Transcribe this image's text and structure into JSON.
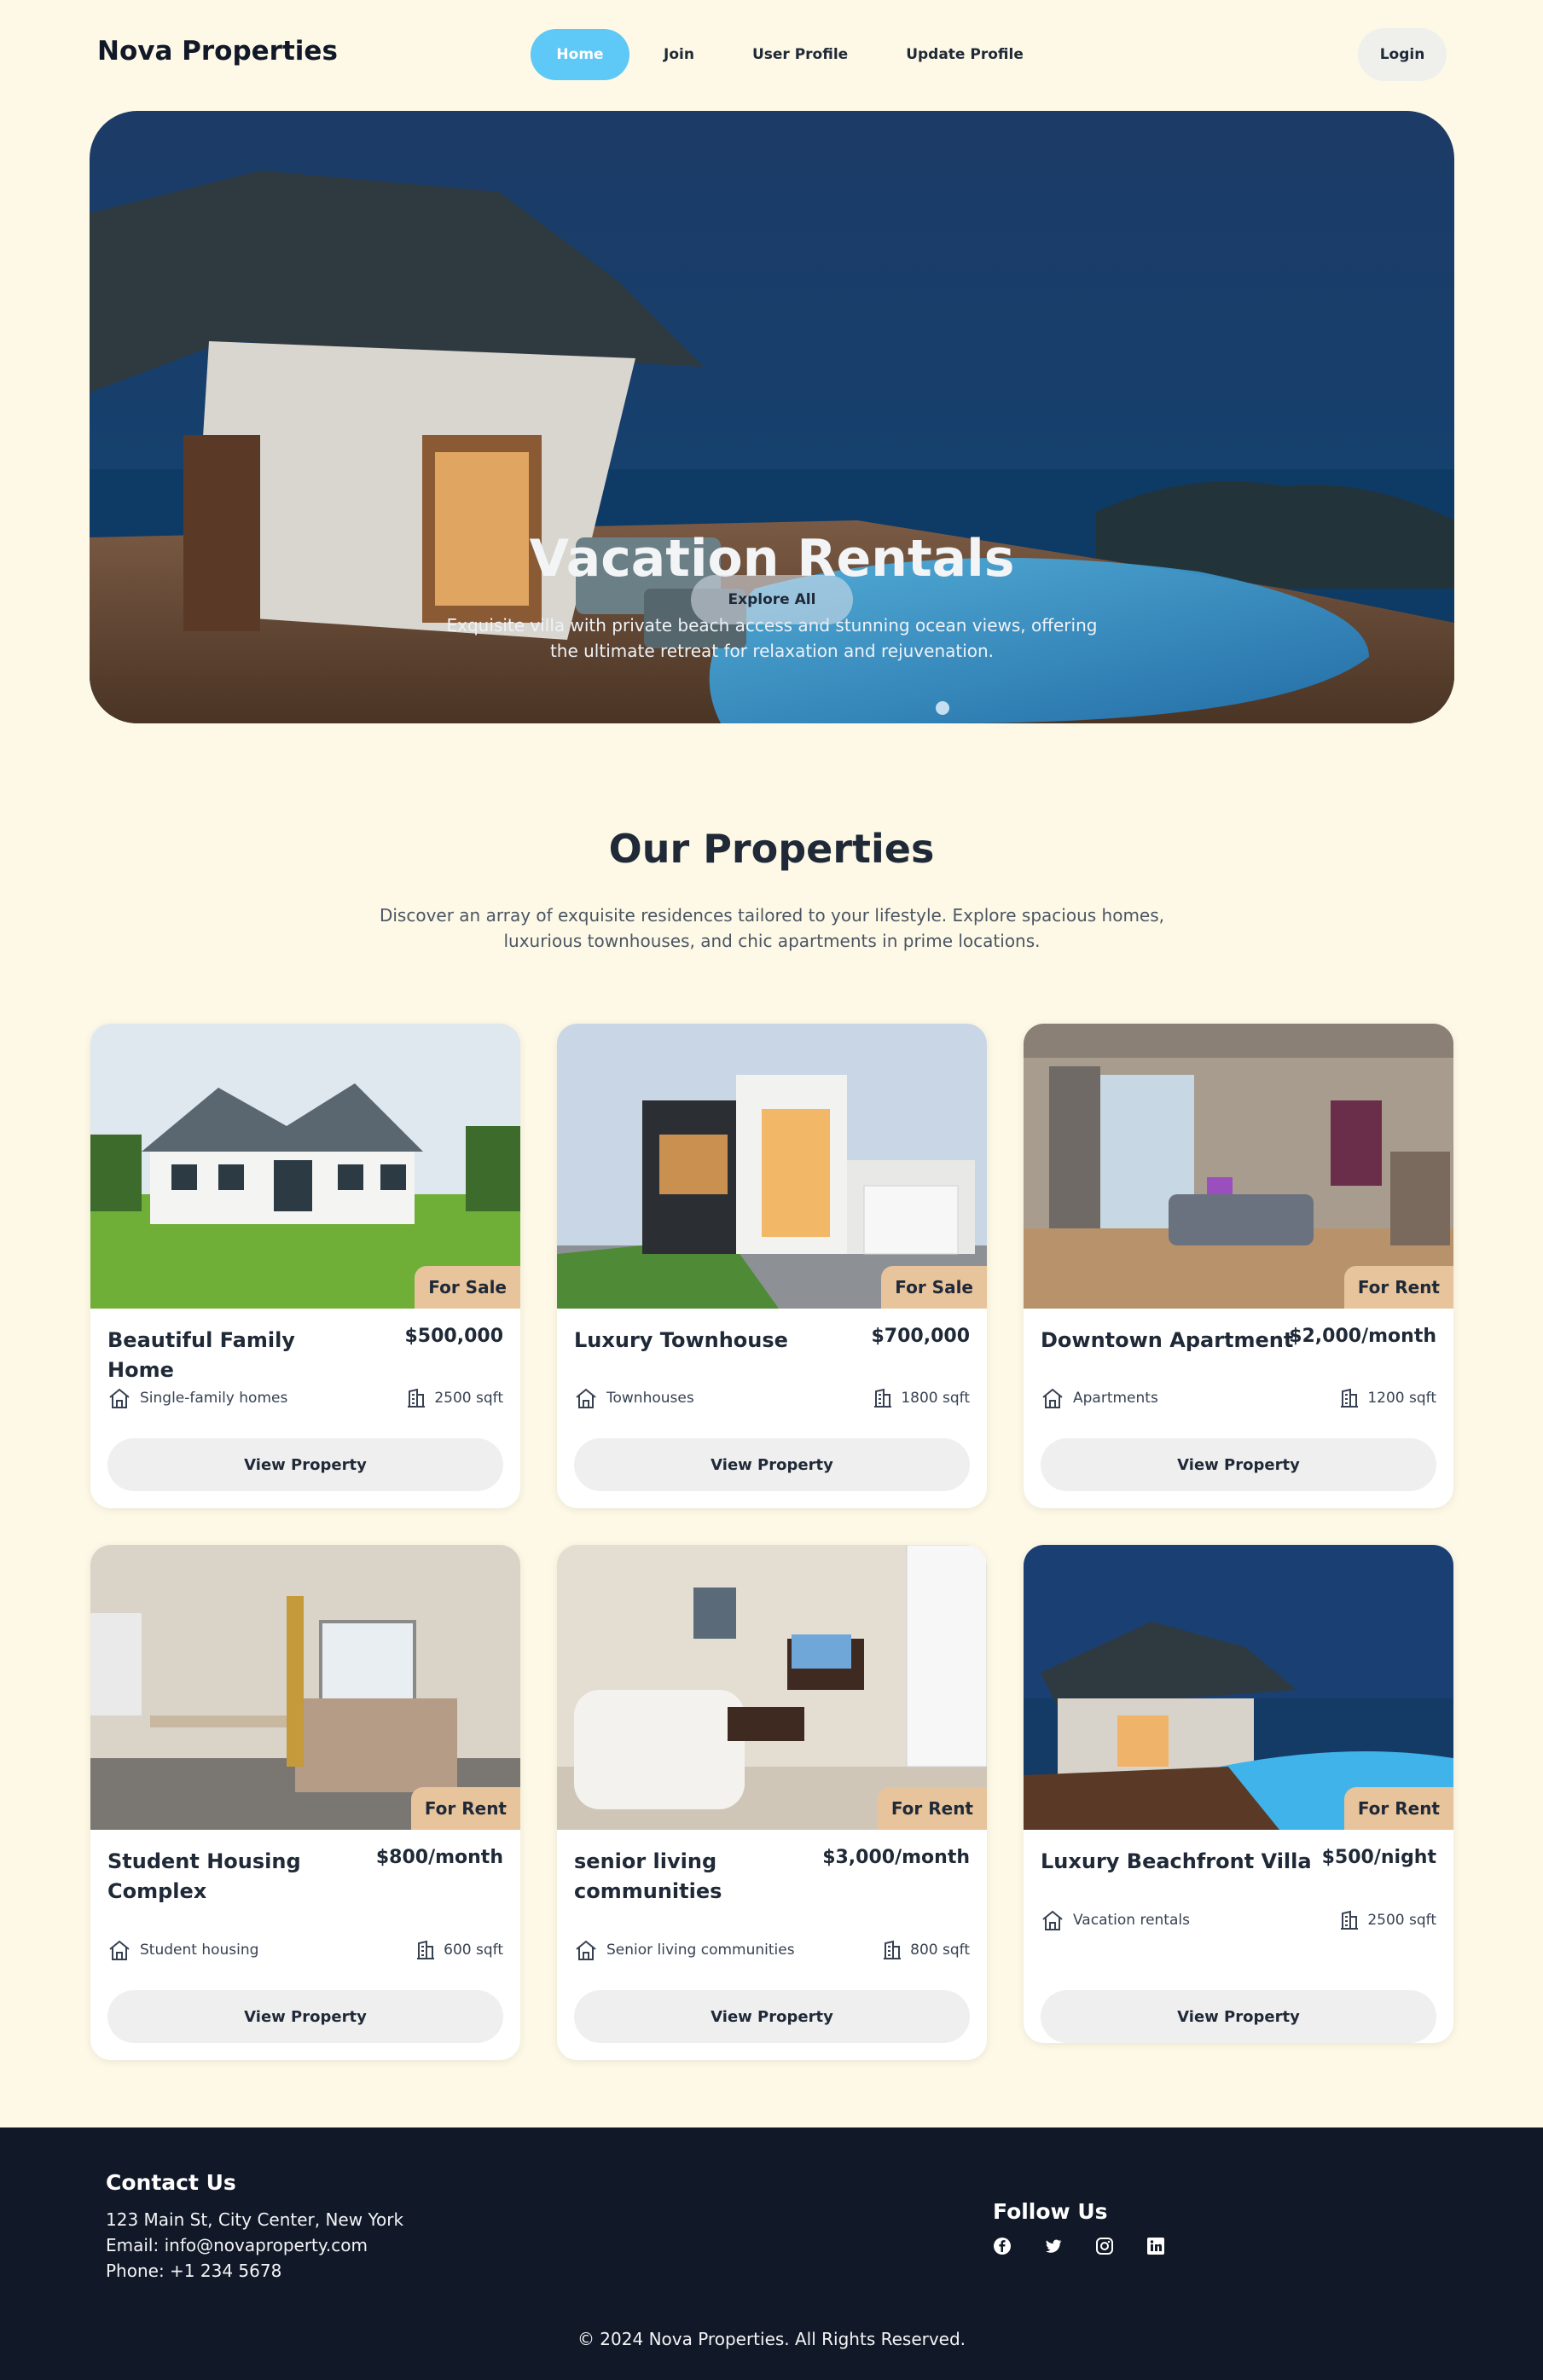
{
  "brand": "Nova Properties",
  "nav": {
    "links": [
      {
        "label": "Home",
        "active": true
      },
      {
        "label": "Join",
        "active": false
      },
      {
        "label": "User Profile",
        "active": false
      },
      {
        "label": "Update Profile",
        "active": false
      }
    ],
    "login": "Login"
  },
  "hero": {
    "title": "Vacation Rentals",
    "subtitle": "Exquisite villa with private beach access and stunning ocean views, offering the ultimate retreat for relaxation and rejuvenation.",
    "button": "Explore All"
  },
  "properties_section": {
    "title": "Our Properties",
    "subtitle": "Discover an array of exquisite residences tailored to your lifestyle. Explore spacious homes, luxurious townhouses, and chic apartments in prime locations."
  },
  "properties": [
    {
      "title": "Beautiful Family Home",
      "price": "$500,000",
      "status": "For Sale",
      "type": "Single-family homes",
      "area": "2500 sqft",
      "button": "View Property"
    },
    {
      "title": "Luxury Townhouse",
      "price": "$700,000",
      "status": "For Sale",
      "type": "Townhouses",
      "area": "1800 sqft",
      "button": "View Property"
    },
    {
      "title": "Downtown Apartment",
      "price": "$2,000/month",
      "status": "For Rent",
      "type": "Apartments",
      "area": "1200 sqft",
      "button": "View Property"
    },
    {
      "title": "Student Housing Complex",
      "price": "$800/month",
      "status": "For Rent",
      "type": "Student housing",
      "area": "600 sqft",
      "button": "View Property"
    },
    {
      "title": "senior living communities",
      "price": "$3,000/month",
      "status": "For Rent",
      "type": "Senior living communities",
      "area": "800 sqft",
      "button": "View Property"
    },
    {
      "title": "Luxury Beachfront Villa",
      "price": "$500/night",
      "status": "For Rent",
      "type": "Vacation rentals",
      "area": "2500 sqft",
      "button": "View Property"
    }
  ],
  "footer": {
    "contact_title": "Contact Us",
    "address": "123 Main St, City Center, New York",
    "email": "Email: info@novaproperty.com",
    "phone": "Phone: +1 234 5678",
    "follow_title": "Follow Us",
    "socials": [
      "facebook-icon",
      "twitter-icon",
      "instagram-icon",
      "linkedin-icon"
    ],
    "copyright": "© 2024 Nova Properties. All Rights Reserved."
  },
  "colors": {
    "page_bg": "#fdf9e6",
    "accent": "#5ec8f6",
    "tag_bg": "#e7c49b",
    "footer_bg": "#111827"
  }
}
